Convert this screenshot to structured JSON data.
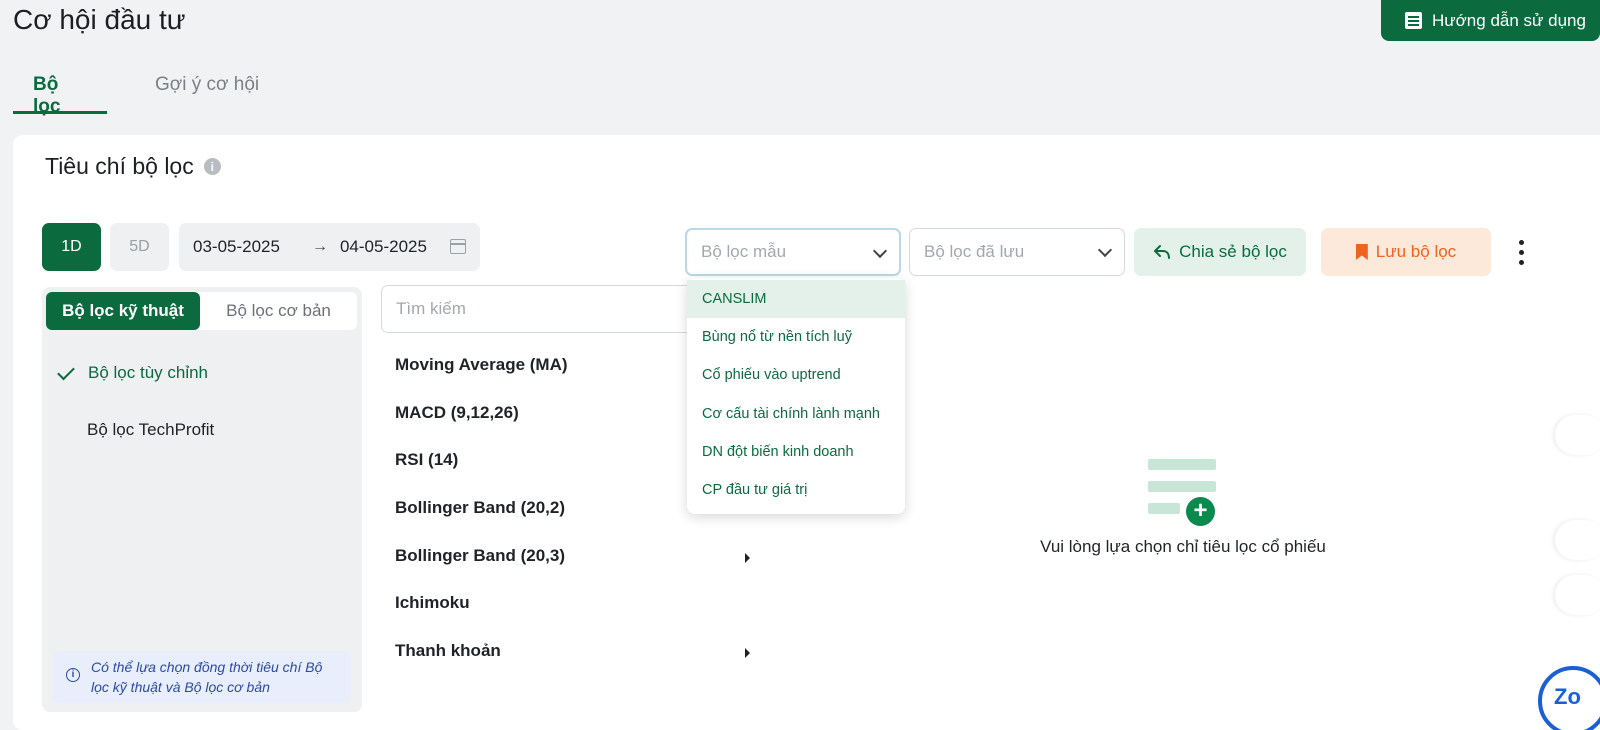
{
  "page": {
    "title": "Cơ hội đầu tư"
  },
  "header": {
    "guide_label": "Hướng dẫn sử dụng"
  },
  "tabs": [
    {
      "label": "Bộ lọc",
      "active": true
    },
    {
      "label": "Gợi ý cơ hội",
      "active": false
    }
  ],
  "criteria": {
    "title": "Tiêu chí bộ lọc",
    "info_glyph": "i",
    "periods": [
      "1D",
      "5D"
    ],
    "active_period": "1D",
    "date_from": "03-05-2025",
    "date_arrow": "→",
    "date_to": "04-05-2025"
  },
  "filters": {
    "sample_placeholder": "Bộ lọc mẫu",
    "saved_placeholder": "Bộ lọc đã lưu",
    "share_label": "Chia sẻ bộ lọc",
    "save_label": "Lưu bộ lọc"
  },
  "left_panel": {
    "segments": [
      "Bộ lọc kỹ thuật",
      "Bộ lọc cơ bản"
    ],
    "items": [
      "Bộ lọc tùy chỉnh",
      "Bộ lọc TechProfit"
    ],
    "note": "Có thể lựa chọn đồng thời tiêu chí Bộ lọc kỹ thuật và Bộ lọc cơ bản"
  },
  "search": {
    "placeholder": "Tìm kiếm"
  },
  "indicators": [
    "Moving Average (MA)",
    "MACD (9,12,26)",
    "RSI (14)",
    "Bollinger Band (20,2)",
    "Bollinger Band (20,3)",
    "Ichimoku",
    "Thanh khoản"
  ],
  "sample_dropdown": {
    "options": [
      "CANSLIM",
      "Bùng nổ từ nền tích luỹ",
      "Cổ phiếu vào uptrend",
      "Cơ cấu tài chính lành mạnh",
      "DN đột biến kinh doanh",
      "CP đầu tư giá trị"
    ],
    "highlighted": "CANSLIM"
  },
  "empty_state": {
    "text": "Vui lòng lựa chọn chỉ tiêu lọc cổ phiếu",
    "plus_glyph": "+"
  },
  "zalo": {
    "label": "Zo"
  },
  "colors": {
    "primary": "#0b6b3f",
    "accent_orange": "#f0621f",
    "note_blue": "#2d49a8"
  }
}
